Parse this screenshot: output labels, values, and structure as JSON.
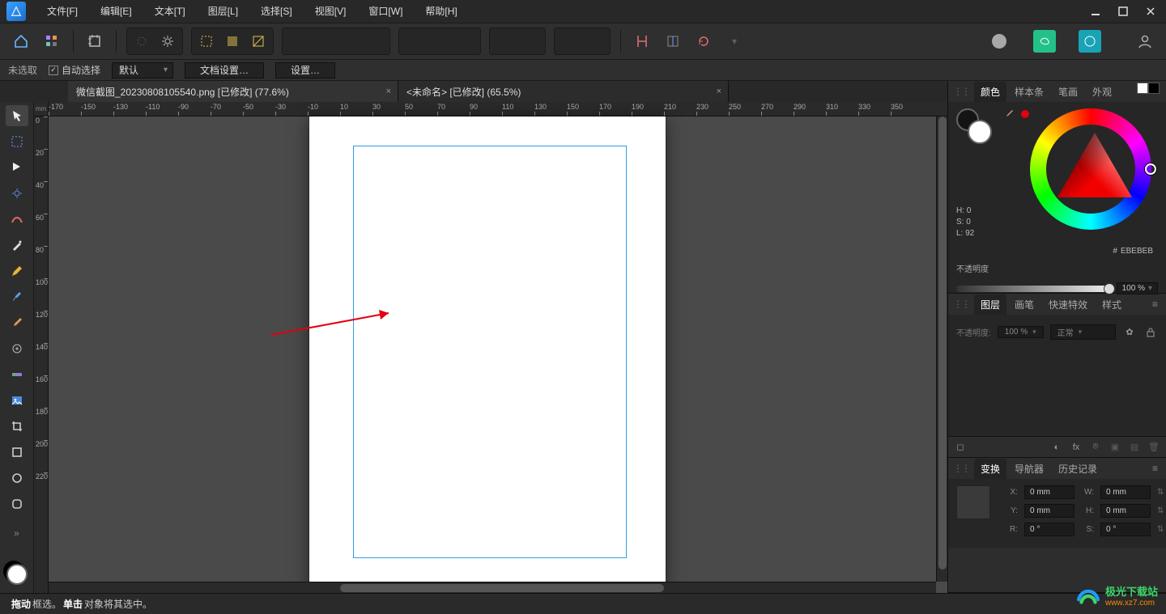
{
  "menu": {
    "items": [
      "文件[F]",
      "编辑[E]",
      "文本[T]",
      "图层[L]",
      "选择[S]",
      "视图[V]",
      "窗口[W]",
      "帮助[H]"
    ]
  },
  "context": {
    "status": "未选取",
    "auto_select_label": "自动选择",
    "select_mode": "默认",
    "doc_settings": "文档设置…",
    "settings": "设置…"
  },
  "tabs": [
    {
      "label": "微信截图_20230808105540.png [已修改] (77.6%)"
    },
    {
      "label": "<未命名> [已修改] (65.5%)"
    }
  ],
  "ruler": {
    "unit": "mm",
    "h_values": [
      "-170",
      "-150",
      "-130",
      "-110",
      "-90",
      "-70",
      "-50",
      "-30",
      "-10",
      "10",
      "30",
      "50",
      "70",
      "90",
      "110",
      "130",
      "150",
      "170",
      "190",
      "210",
      "230",
      "250",
      "270",
      "290",
      "310",
      "330",
      "350"
    ],
    "v_values": [
      "0",
      "20",
      "40",
      "60",
      "80",
      "100",
      "120",
      "140",
      "160",
      "180",
      "200",
      "220"
    ]
  },
  "panels": {
    "color": {
      "tabs": [
        "颜色",
        "样本条",
        "笔画",
        "外观"
      ],
      "hsl": {
        "H": "H: 0",
        "S": "S: 0",
        "L": "L: 92"
      },
      "hex_prefix": "#",
      "hex": "EBEBEB",
      "opacity_label": "不透明度",
      "opacity_value": "100 %"
    },
    "layers": {
      "tabs": [
        "图层",
        "画笔",
        "快速特效",
        "样式"
      ],
      "opacity_label": "不透明度:",
      "opacity_value": "100 %",
      "blend_mode": "正常"
    },
    "transform": {
      "tabs": [
        "变换",
        "导航器",
        "历史记录"
      ],
      "X_label": "X:",
      "X": "0 mm",
      "Y_label": "Y:",
      "Y": "0 mm",
      "W_label": "W:",
      "W": "0 mm",
      "H_label": "H:",
      "H": "0 mm",
      "R_label": "R:",
      "R": "0 °",
      "S_label": "S:",
      "S": "0 °"
    }
  },
  "status": {
    "b1": "拖动",
    "t1": " 框选。",
    "b2": "单击",
    "t2": " 对象将其选中。"
  },
  "watermark": {
    "brand": "极光下载站",
    "url": "www.xz7.com"
  }
}
